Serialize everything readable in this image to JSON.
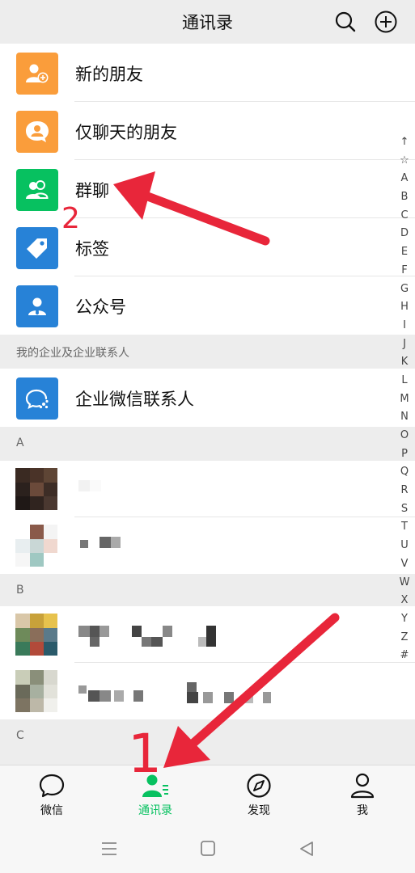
{
  "header": {
    "title": "通讯录"
  },
  "features": [
    {
      "label": "新的朋友",
      "color": "#fa9d3b",
      "icon": "add-friend-icon"
    },
    {
      "label": "仅聊天的朋友",
      "color": "#fa9d3b",
      "icon": "chat-only-friend-icon"
    },
    {
      "label": "群聊",
      "color": "#07c160",
      "icon": "group-chat-icon"
    },
    {
      "label": "标签",
      "color": "#2782d7",
      "icon": "tag-icon"
    },
    {
      "label": "公众号",
      "color": "#2782d7",
      "icon": "official-account-icon"
    }
  ],
  "enterprise": {
    "section_label": "我的企业及企业联系人",
    "item_label": "企业微信联系人",
    "color": "#2782d7"
  },
  "sections": {
    "a": "A",
    "b": "B",
    "c": "C"
  },
  "index": [
    "↑",
    "☆",
    "A",
    "B",
    "C",
    "D",
    "E",
    "F",
    "G",
    "H",
    "I",
    "J",
    "K",
    "L",
    "M",
    "N",
    "O",
    "P",
    "Q",
    "R",
    "S",
    "T",
    "U",
    "V",
    "W",
    "X",
    "Y",
    "Z",
    "#"
  ],
  "tabs": [
    {
      "label": "微信",
      "icon": "chat-bubble-icon"
    },
    {
      "label": "通讯录",
      "icon": "contacts-icon",
      "active": true
    },
    {
      "label": "发现",
      "icon": "compass-icon"
    },
    {
      "label": "我",
      "icon": "person-icon"
    }
  ],
  "annotations": {
    "step1": "1",
    "step2": "2"
  },
  "colors": {
    "accent": "#07c160",
    "annotation": "#e8263a"
  }
}
